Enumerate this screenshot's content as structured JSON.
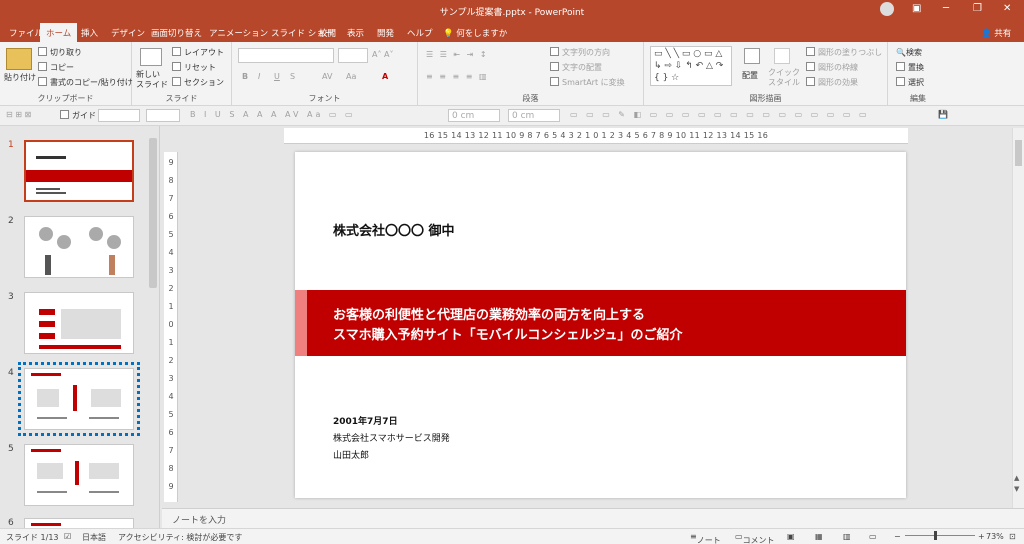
{
  "window": {
    "title": "サンプル提案書.pptx - PowerPoint",
    "minimize": "─",
    "restore": "❐",
    "close": "✕"
  },
  "tabs": [
    "ファイル",
    "ホーム",
    "挿入",
    "デザイン",
    "画面切り替え",
    "アニメーション",
    "スライド ショー",
    "校閲",
    "表示",
    "開発",
    "ヘルプ",
    "何をしますか"
  ],
  "share": "共有",
  "ribbon": {
    "clipboard": {
      "paste": "貼り付け",
      "cut": "切り取り",
      "copy": "コピー",
      "format_painter": "書式のコピー/貼り付け",
      "label": "クリップボード"
    },
    "slides": {
      "new_slide": "新しい\nスライド",
      "layout": "レイアウト",
      "reset": "リセット",
      "section": "セクション",
      "label": "スライド"
    },
    "font": {
      "bold": "B",
      "italic": "I",
      "underline": "U",
      "strike": "S",
      "spacing": "AV",
      "case": "Aa",
      "label": "フォント"
    },
    "paragraph": {
      "text_dir": "文字列の方向",
      "align_text": "文字の配置",
      "smartart": "SmartArt に変換",
      "label": "段落"
    },
    "drawing": {
      "arrange": "配置",
      "quick_styles": "クイック\nスタイル",
      "fill": "図形の塗りつぶし",
      "outline": "図形の枠線",
      "effects": "図形の効果",
      "label": "図形描画"
    },
    "editing": {
      "find": "検索",
      "replace": "置換",
      "select": "選択",
      "label": "編集"
    }
  },
  "qat": {
    "guide": "ガイド",
    "cm1": "0 cm",
    "cm2": "0 cm"
  },
  "ruler": {
    "h": "16 15 14 13 12 11 10 9 8 7 6 5 4 3 2 1 0 1 2 3 4 5 6 7 8 9 10 11 12 13 14 15 16",
    "v": [
      "9",
      "8",
      "7",
      "6",
      "5",
      "4",
      "3",
      "2",
      "1",
      "0",
      "1",
      "2",
      "3",
      "4",
      "5",
      "6",
      "7",
      "8",
      "9"
    ]
  },
  "thumbnails": [
    {
      "num": "1"
    },
    {
      "num": "2"
    },
    {
      "num": "3"
    },
    {
      "num": "4"
    },
    {
      "num": "5"
    },
    {
      "num": "6"
    }
  ],
  "slide": {
    "addressee": "株式会社〇〇〇 御中",
    "title_line1": "お客様の利便性と代理店の業務効率の両方を向上する",
    "title_line2": "スマホ購入予約サイト「モバイルコンシェルジュ」のご紹介",
    "date": "2001年7月7日",
    "company": "株式会社スマホサービス開発",
    "person": "山田太郎"
  },
  "notes_placeholder": "ノートを入力",
  "status": {
    "slide": "スライド 1/13",
    "lang": "日本語",
    "accessibility": "アクセシビリティ: 検討が必要です",
    "notes": "ノート",
    "comments": "コメント",
    "zoom": "73%"
  },
  "colors": {
    "accent": "#b7472a",
    "band": "#c00000",
    "band_light": "#f08080",
    "selection": "#0070c0"
  }
}
